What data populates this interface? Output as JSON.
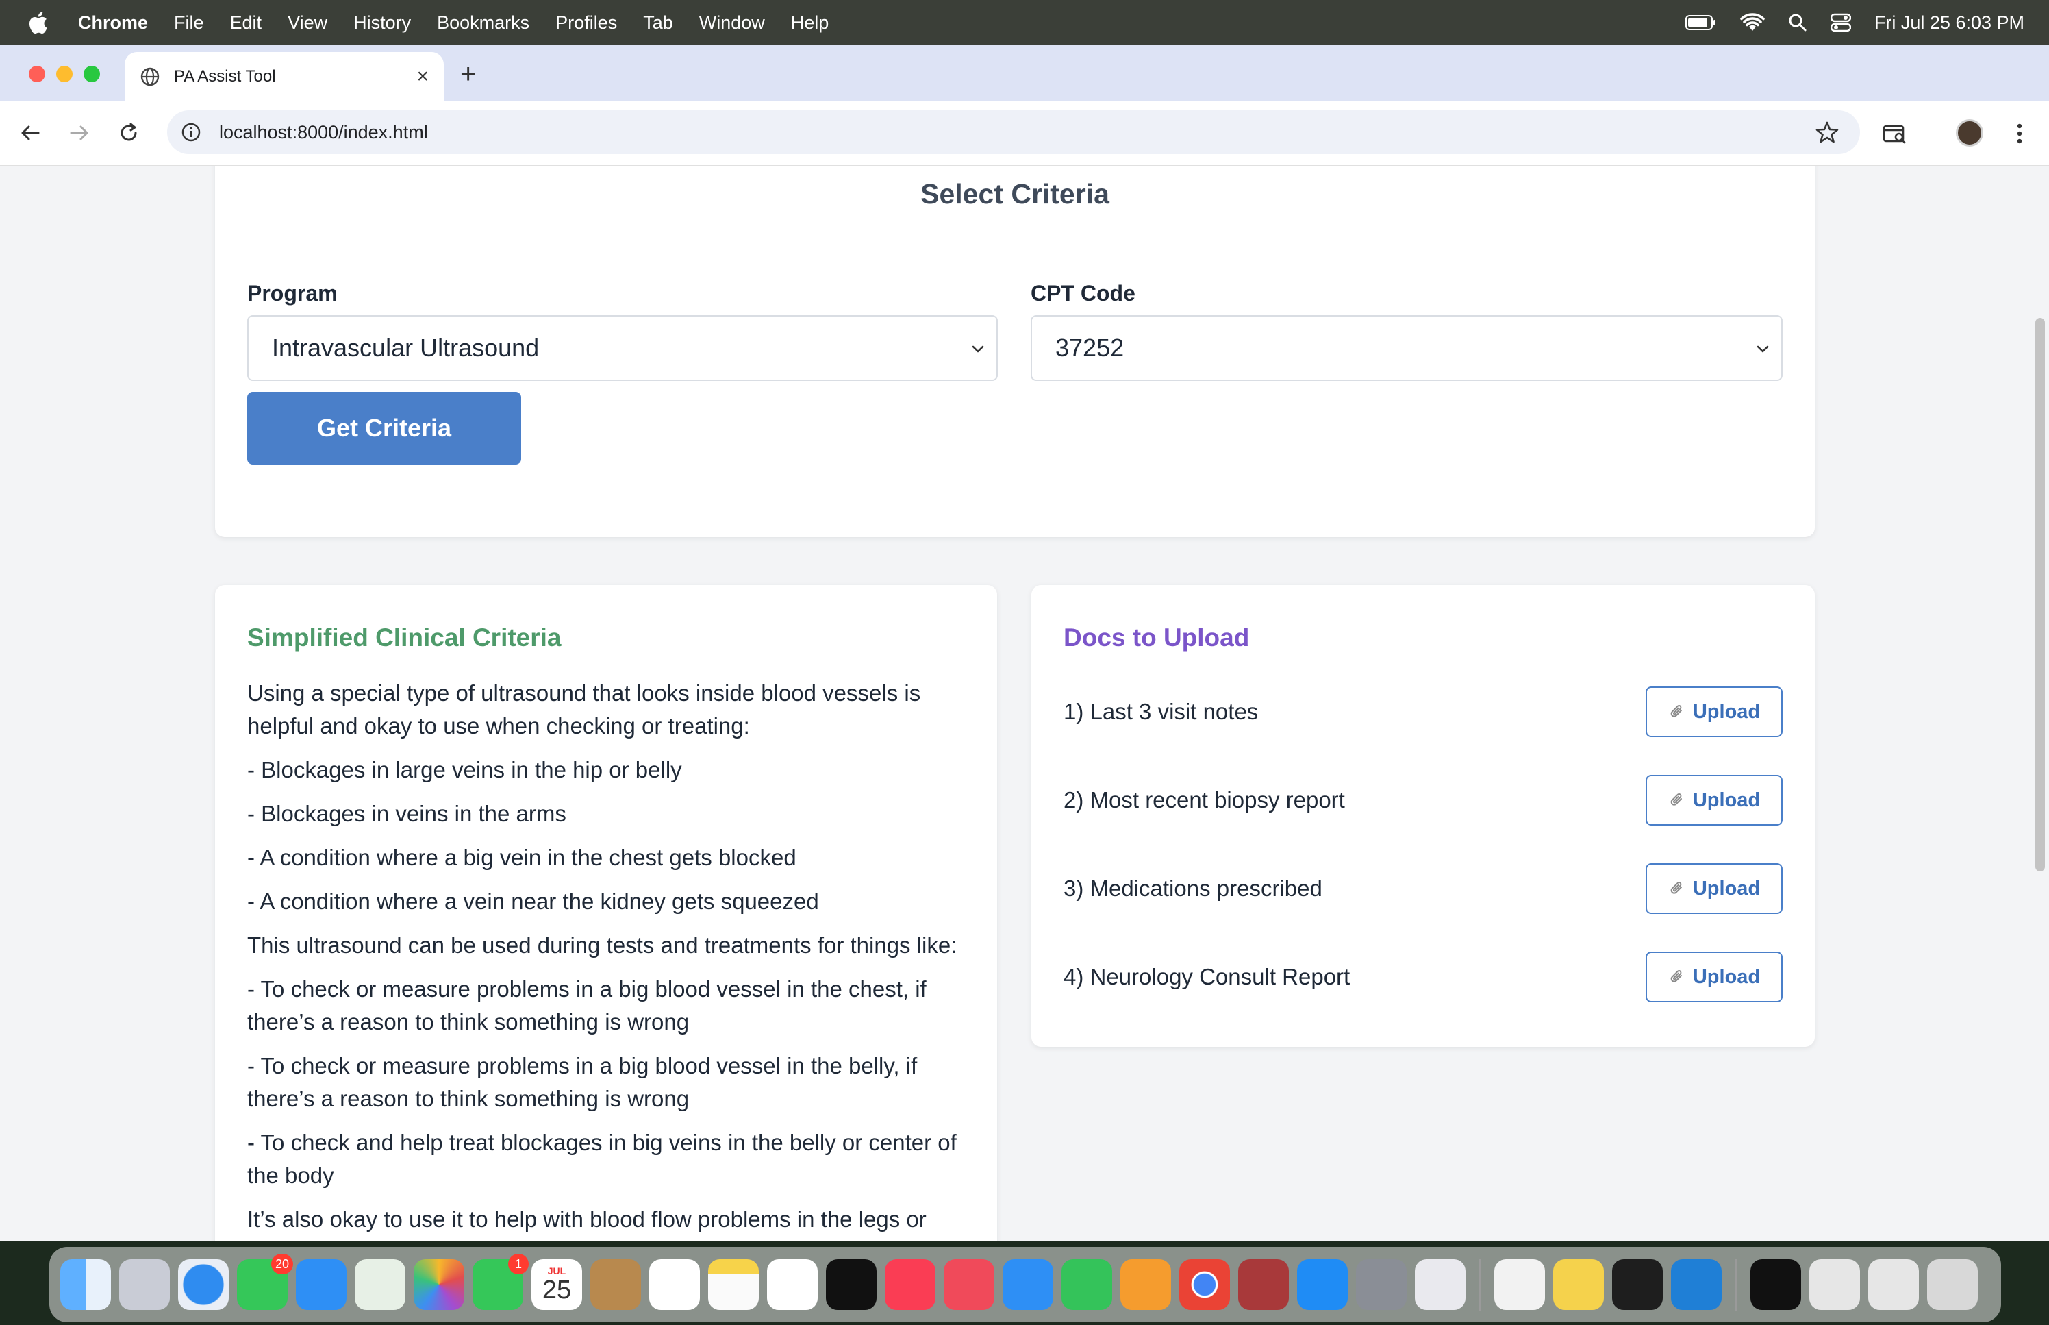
{
  "menubar": {
    "app_name": "Chrome",
    "items": [
      "File",
      "Edit",
      "View",
      "History",
      "Bookmarks",
      "Profiles",
      "Tab",
      "Window",
      "Help"
    ],
    "datetime": "Fri Jul 25  6:03 PM"
  },
  "browser": {
    "tab_title": "PA Assist Tool",
    "url": "localhost:8000/index.html"
  },
  "criteria": {
    "title": "Select Criteria",
    "program_label": "Program",
    "program_value": "Intravascular Ultrasound",
    "cpt_label": "CPT Code",
    "cpt_value": "37252",
    "button_label": "Get Criteria"
  },
  "clinical": {
    "title": "Simplified Clinical Criteria",
    "paragraphs": [
      "Using a special type of ultrasound that looks inside blood vessels is helpful and okay to use when checking or treating:",
      "- Blockages in large veins in the hip or belly",
      "- Blockages in veins in the arms",
      "- A condition where a big vein in the chest gets blocked",
      "- A condition where a vein near the kidney gets squeezed",
      "This ultrasound can be used during tests and treatments for things like:",
      "- To check or measure problems in a big blood vessel in the chest, if there’s a reason to think something is wrong",
      "- To check or measure problems in a big blood vessel in the belly, if there’s a reason to think something is wrong",
      "- To check and help treat blockages in big veins in the belly or center of the body",
      "It’s also okay to use it to help with blood flow problems in the legs or swelling in certain blood vessels."
    ]
  },
  "docs": {
    "title": "Docs to Upload",
    "upload_label": "Upload",
    "items": [
      "1) Last 3 visit notes",
      "2) Most recent biopsy report",
      "3) Medications prescribed",
      "4) Neurology Consult Report"
    ]
  },
  "dock": {
    "badges": {
      "messages": "20",
      "facetime": "1"
    },
    "calendar_month": "JUL",
    "calendar_day": "25"
  },
  "colors": {
    "accent_blue": "#4a7fc9",
    "clinical_green": "#4e9a6a",
    "docs_purple": "#7b55c9"
  }
}
